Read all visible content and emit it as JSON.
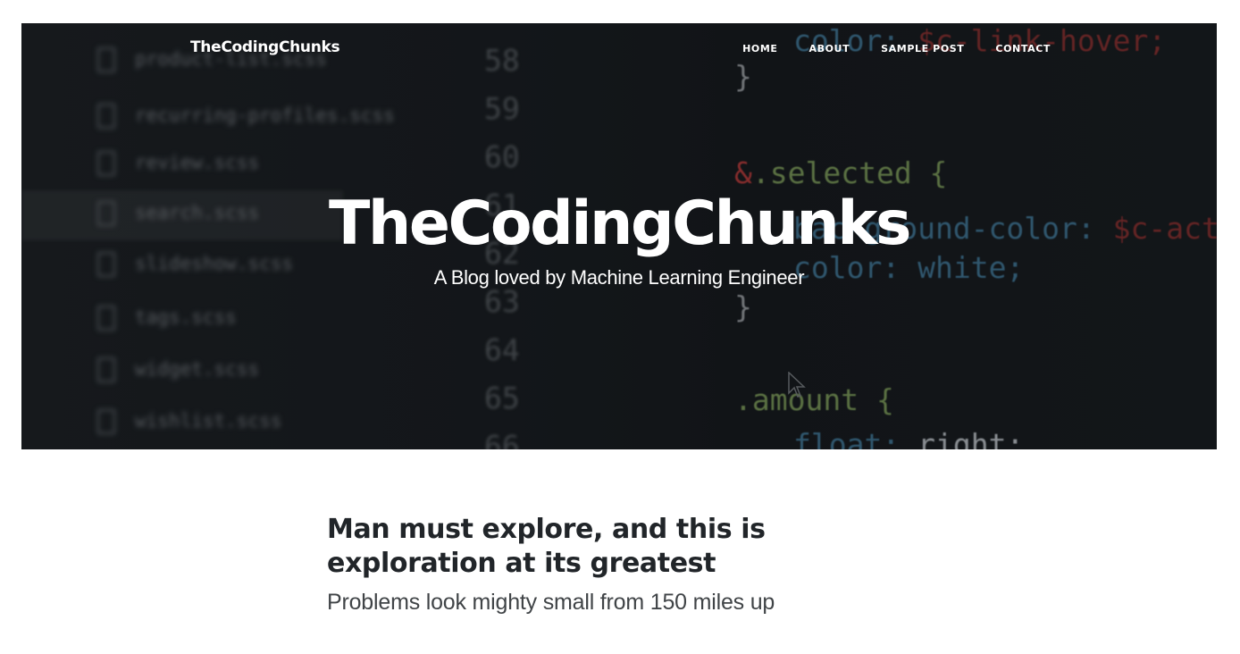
{
  "nav": {
    "brand": "TheCodingChunks",
    "links": [
      "Home",
      "About",
      "Sample Post",
      "Contact"
    ]
  },
  "hero": {
    "title": "TheCodingChunks",
    "subtitle": "A Blog loved by Machine Learning Engineer",
    "background": {
      "files": [
        "product-list.scss",
        "recurring-profiles.scss",
        "review.scss",
        "search.scss",
        "slideshow.scss",
        "tags.scss",
        "widget.scss",
        "wishlist.scss"
      ],
      "line_numbers": [
        "58",
        "59",
        "60",
        "61",
        "62",
        "63",
        "64",
        "65",
        "66"
      ],
      "code": {
        "line1a": "color:",
        "line1b": "$c-link-hover;",
        "brace_close_1": "}",
        "amp": "&",
        "selected": ".selected {",
        "bg_prop": "background-color:",
        "bg_val": "$c-action;",
        "color_prop": "color:",
        "color_val": "white;",
        "brace_close_2": "}",
        "amount": ".amount {",
        "float_prop": "float:",
        "float_val": "right;"
      }
    }
  },
  "post": {
    "title": "Man must explore, and this is exploration at its greatest",
    "subtitle": "Problems look mighty small from 150 miles up"
  },
  "colors": {
    "hero_bg": "#181c20",
    "text_dark": "#212529",
    "white": "#ffffff"
  }
}
